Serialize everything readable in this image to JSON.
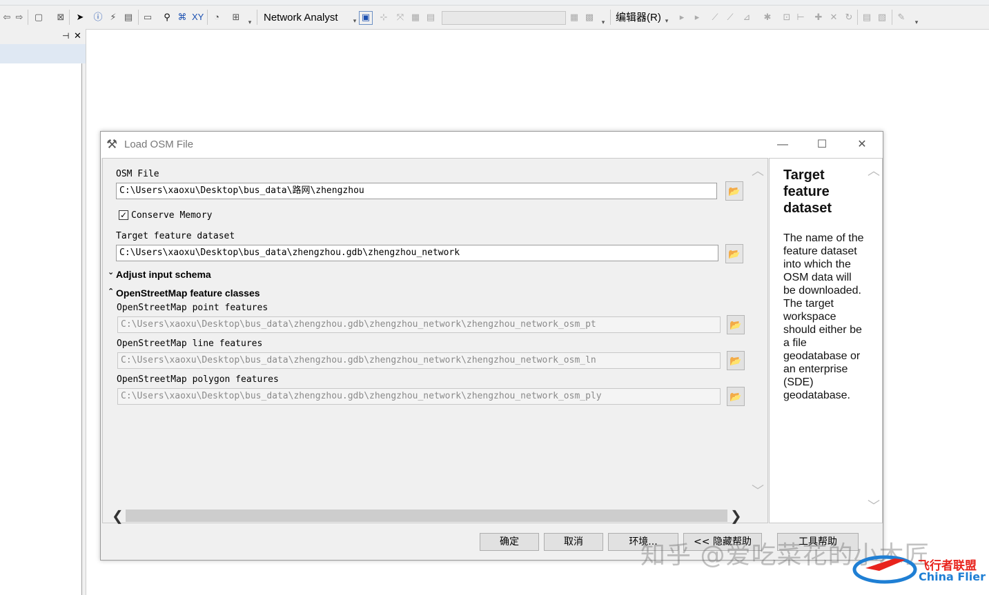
{
  "toolbar": {
    "network_analyst_label": "Network Analyst",
    "editor_label": "编辑器(R)"
  },
  "left_panel": {
    "pin_icon": "pin-icon",
    "close_icon": "close-icon"
  },
  "dialog": {
    "title": "Load OSM File",
    "osm_file_label": "OSM File",
    "osm_file_value": "C:\\Users\\xaoxu\\Desktop\\bus_data\\路网\\zhengzhou",
    "conserve_memory_label": "Conserve Memory",
    "conserve_memory_checked": true,
    "target_label": "Target feature dataset",
    "target_value": "C:\\Users\\xaoxu\\Desktop\\bus_data\\zhengzhou.gdb\\zhengzhou_network",
    "adjust_schema_label": "Adjust input schema",
    "osm_classes_label": "OpenStreetMap feature classes",
    "point_label": "OpenStreetMap point features",
    "point_value": "C:\\Users\\xaoxu\\Desktop\\bus_data\\zhengzhou.gdb\\zhengzhou_network\\zhengzhou_network_osm_pt",
    "line_label": "OpenStreetMap line features",
    "line_value": "C:\\Users\\xaoxu\\Desktop\\bus_data\\zhengzhou.gdb\\zhengzhou_network\\zhengzhou_network_osm_ln",
    "polygon_label": "OpenStreetMap polygon features",
    "polygon_value": "C:\\Users\\xaoxu\\Desktop\\bus_data\\zhengzhou.gdb\\zhengzhou_network\\zhengzhou_network_osm_ply"
  },
  "help": {
    "title": "Target feature dataset",
    "body": "The name of the feature dataset into which the OSM data will be downloaded. The target workspace should either be a file geodatabase or an enterprise (SDE) geodatabase."
  },
  "buttons": {
    "ok": "确定",
    "cancel": "取消",
    "environments": "环境...",
    "hide_help": "<< 隐藏帮助",
    "tool_help": "工具帮助"
  },
  "watermark": {
    "text": "知乎 @爱吃菜花的小木匠",
    "logo_cn": "飞行者联盟",
    "logo_en": "China Flier"
  },
  "colors": {
    "logo_red": "#e8231c",
    "logo_blue": "#1f7fd4",
    "folder_yellow": "#b98400"
  }
}
